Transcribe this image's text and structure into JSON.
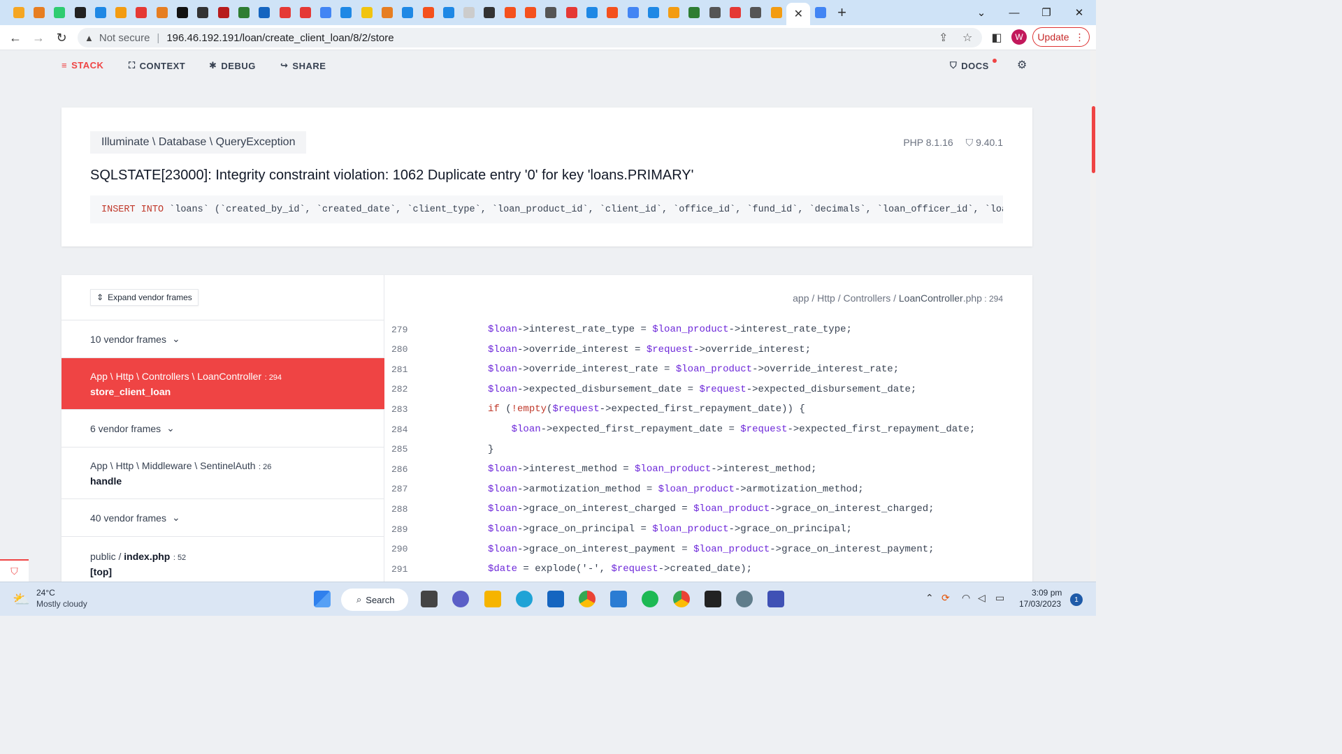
{
  "browser": {
    "active_tab_close": "✕",
    "new_tab": "+",
    "not_secure_label": "Not secure",
    "url": "196.46.192.191/loan/create_client_loan/8/2/store",
    "avatar_letter": "W",
    "update_label": "Update",
    "tab_colors": [
      "#f5a623",
      "#e67e22",
      "#2ecc71",
      "#222222",
      "#1e88e5",
      "#f39c12",
      "#e53935",
      "#e67e22",
      "#111111",
      "#333333",
      "#b71c1c",
      "#2e7d32",
      "#1565c0",
      "#e53935",
      "#e53935",
      "#4285f4",
      "#1e88e5",
      "#f1c40f",
      "#e67e22",
      "#1e88e5",
      "#f4511e",
      "#1e88e5",
      "#cccccc",
      "#333333",
      "#f4511e",
      "#f4511e",
      "#555555",
      "#e53935",
      "#1e88e5",
      "#f4511e",
      "#4285f4",
      "#1e88e5",
      "#f39c12",
      "#2e7d32",
      "#555555",
      "#e53935",
      "#555555",
      "#f39c12",
      "#4285f4"
    ]
  },
  "ignition": {
    "nav": {
      "stack": "STACK",
      "context": "CONTEXT",
      "debug": "DEBUG",
      "share": "SHARE",
      "docs": "DOCS"
    },
    "exception_class": "Illuminate \\ Database \\ QueryException",
    "php_version": "PHP 8.1.16",
    "laravel_version": "9.40.1",
    "message": "SQLSTATE[23000]: Integrity constraint violation: 1062 Duplicate entry '0' for key 'loans.PRIMARY'",
    "sql_keyword": "INSERT INTO",
    "sql_rest": "`loans` (`created_by_id`, `created_date`, `client_type`, `loan_product_id`, `client_id`, `office_id`, `fund_id`, `decimals`, `loan_officer_id`, `loan_",
    "expand_vendor_label": "Expand vendor frames",
    "frames": {
      "vendor1": "10 vendor frames",
      "active_path": "App \\ Http \\ Controllers \\ LoanController",
      "active_line": ": 294",
      "active_method": "store_client_loan",
      "vendor2": "6 vendor frames",
      "mw_path": "App \\ Http \\ Middleware \\ SentinelAuth",
      "mw_line": ": 26",
      "mw_method": "handle",
      "vendor3": "40 vendor frames",
      "index_dir": "public / ",
      "index_file": "index.php",
      "index_line": ": 52",
      "index_method": "[top]"
    },
    "code_path": {
      "dir": "app / Http / Controllers / ",
      "file": "LoanController",
      "ext": ".php",
      "line": " : 294"
    },
    "code_lines": [
      {
        "n": "279",
        "t": "$loan->interest_rate_type = $loan_product->interest_rate_type;"
      },
      {
        "n": "280",
        "t": "$loan->override_interest = $request->override_interest;"
      },
      {
        "n": "281",
        "t": "$loan->override_interest_rate = $loan_product->override_interest_rate;"
      },
      {
        "n": "282",
        "t": "$loan->expected_disbursement_date = $request->expected_disbursement_date;"
      },
      {
        "n": "283",
        "t": "if (!empty($request->expected_first_repayment_date)) {"
      },
      {
        "n": "284",
        "t": "    $loan->expected_first_repayment_date = $request->expected_first_repayment_date;"
      },
      {
        "n": "285",
        "t": "}"
      },
      {
        "n": "286",
        "t": "$loan->interest_method = $loan_product->interest_method;"
      },
      {
        "n": "287",
        "t": "$loan->armotization_method = $loan_product->armotization_method;"
      },
      {
        "n": "288",
        "t": "$loan->grace_on_interest_charged = $loan_product->grace_on_interest_charged;"
      },
      {
        "n": "289",
        "t": "$loan->grace_on_principal = $loan_product->grace_on_principal;"
      },
      {
        "n": "290",
        "t": "$loan->grace_on_interest_payment = $loan_product->grace_on_interest_payment;"
      },
      {
        "n": "291",
        "t": "$date = explode('-', $request->created_date);"
      }
    ]
  },
  "taskbar": {
    "temperature": "24°C",
    "weather": "Mostly cloudy",
    "search_label": "Search",
    "time": "3:09 pm",
    "date": "17/03/2023",
    "notification_count": "1"
  },
  "colors": {
    "accent_red": "#ef4444",
    "var_purple": "#6d28d9",
    "keyword_red": "#c0392b"
  }
}
